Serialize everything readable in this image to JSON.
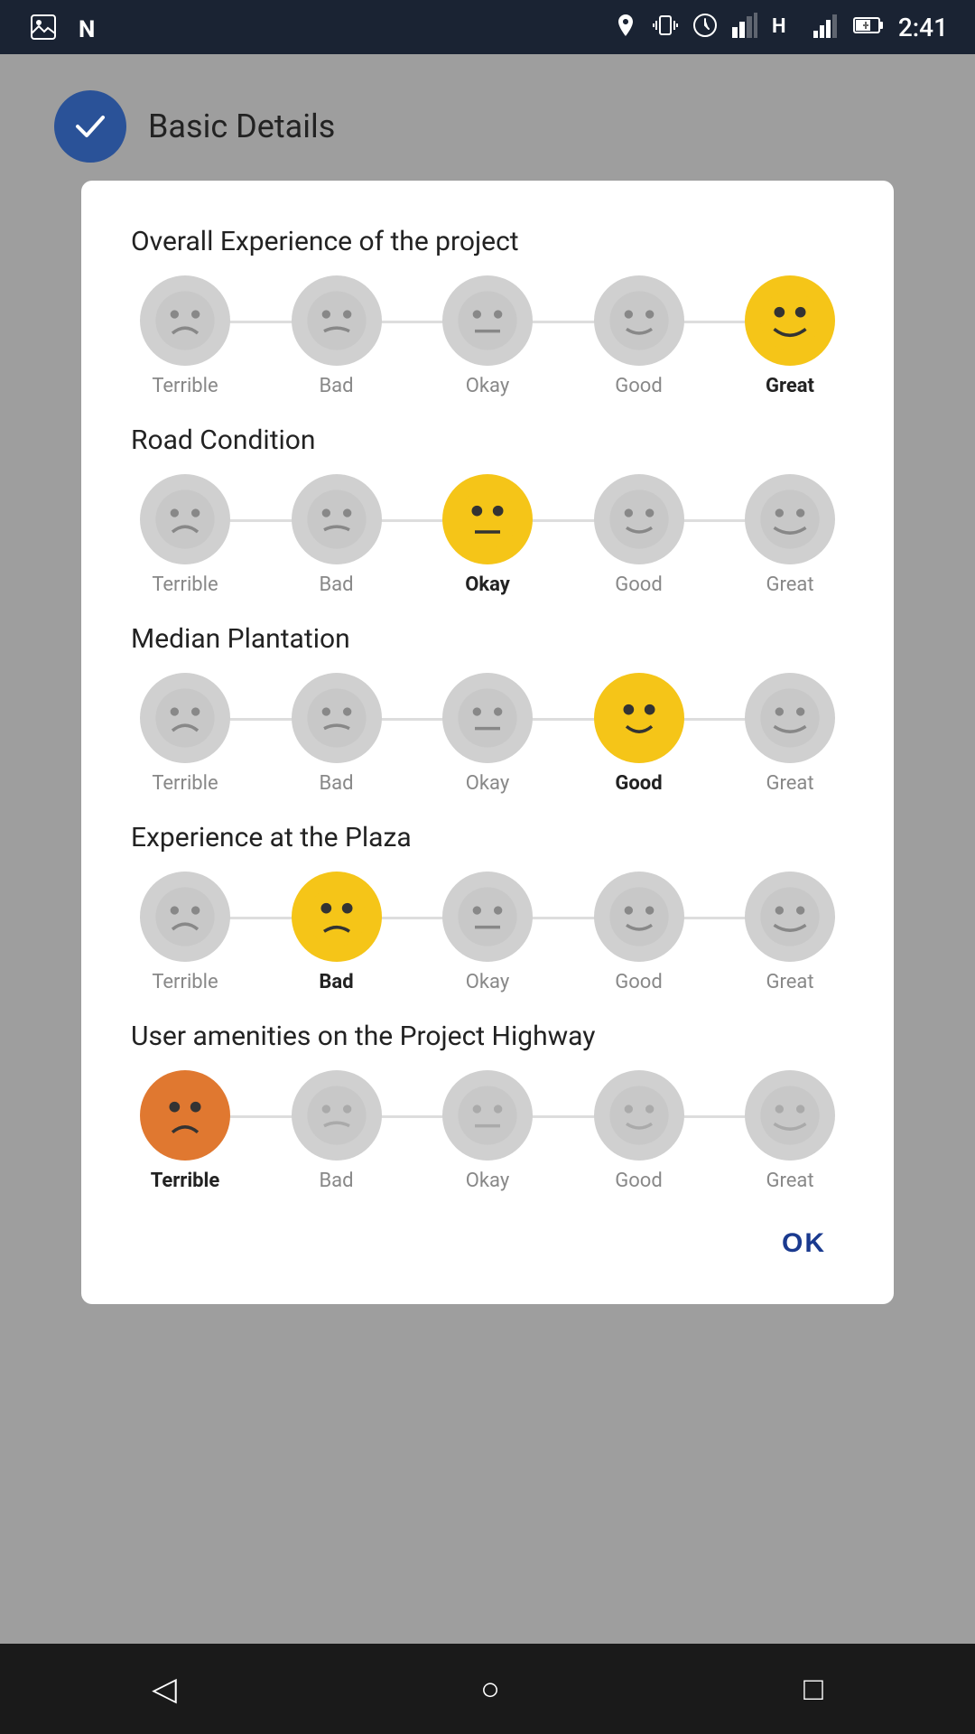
{
  "statusBar": {
    "time": "2:41"
  },
  "header": {
    "title": "Basic Details"
  },
  "dialog": {
    "sections": [
      {
        "id": "overall",
        "title": "Overall Experience of the project",
        "options": [
          "Terrible",
          "Bad",
          "Okay",
          "Good",
          "Great"
        ],
        "selected": 4
      },
      {
        "id": "road",
        "title": "Road Condition",
        "options": [
          "Terrible",
          "Bad",
          "Okay",
          "Good",
          "Great"
        ],
        "selected": 2
      },
      {
        "id": "median",
        "title": "Median Plantation",
        "options": [
          "Terrible",
          "Bad",
          "Okay",
          "Good",
          "Great"
        ],
        "selected": 3
      },
      {
        "id": "plaza",
        "title": "Experience at the Plaza",
        "options": [
          "Terrible",
          "Bad",
          "Okay",
          "Good",
          "Great"
        ],
        "selected": 1
      },
      {
        "id": "amenities",
        "title": "User amenities on the Project Highway",
        "options": [
          "Terrible",
          "Bad",
          "Okay",
          "Good",
          "Great"
        ],
        "selected": 0
      }
    ],
    "okLabel": "OK"
  },
  "nav": {
    "back": "◁",
    "home": "○",
    "recent": "□"
  }
}
